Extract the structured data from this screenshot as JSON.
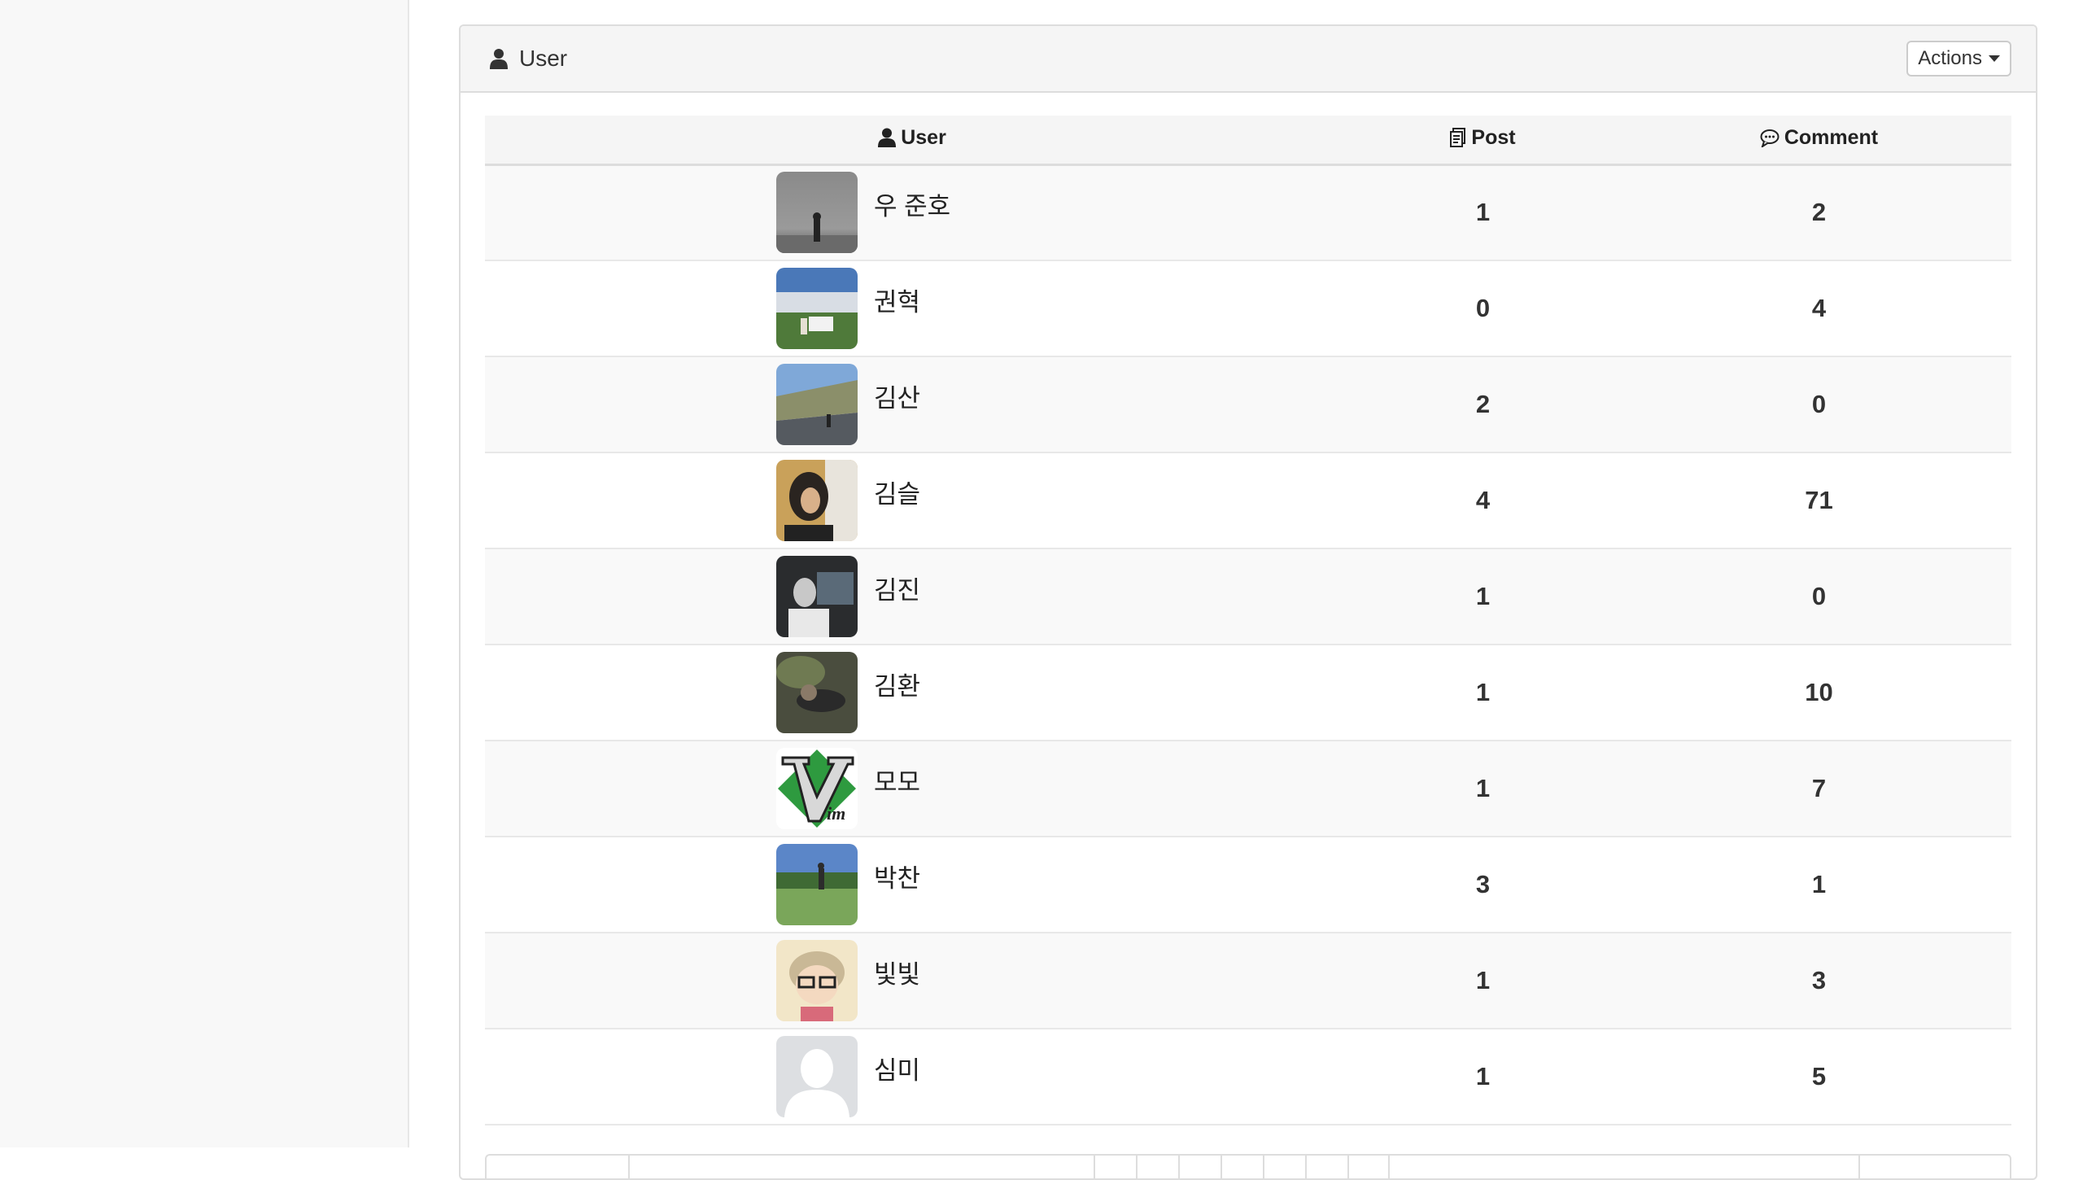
{
  "panel": {
    "title": "User",
    "actions_label": "Actions"
  },
  "table": {
    "headers": {
      "user": "User",
      "post": "Post",
      "comment": "Comment"
    },
    "rows": [
      {
        "name": "우 준호",
        "post": "1",
        "comment": "2"
      },
      {
        "name": "권혁",
        "post": "0",
        "comment": "4"
      },
      {
        "name": "김산",
        "post": "2",
        "comment": "0"
      },
      {
        "name": "김슬",
        "post": "4",
        "comment": "71"
      },
      {
        "name": "김진",
        "post": "1",
        "comment": "0"
      },
      {
        "name": "김환",
        "post": "1",
        "comment": "10"
      },
      {
        "name": "모모",
        "post": "1",
        "comment": "7"
      },
      {
        "name": "박찬",
        "post": "3",
        "comment": "1"
      },
      {
        "name": "빛빛",
        "post": "1",
        "comment": "3"
      },
      {
        "name": "심미",
        "post": "1",
        "comment": "5"
      }
    ]
  },
  "icons": {
    "panel_title_icon": "user-icon",
    "user_header_icon": "user-icon",
    "post_header_icon": "document-icon",
    "comment_header_icon": "comment-icon",
    "actions_caret": "caret-down-icon"
  }
}
